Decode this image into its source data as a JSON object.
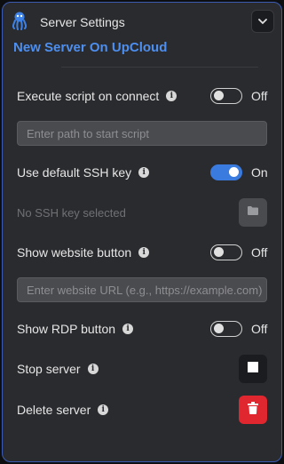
{
  "header": {
    "title": "Server Settings",
    "server_name": "New Server On UpCloud"
  },
  "settings": {
    "execute_script": {
      "label": "Execute script on connect",
      "state": "Off",
      "on": false
    },
    "script_path": {
      "placeholder": "Enter path to start script",
      "value": ""
    },
    "default_ssh": {
      "label": "Use default SSH key",
      "state": "On",
      "on": true
    },
    "ssh_key": {
      "text": "No SSH key selected"
    },
    "website_button": {
      "label": "Show website button",
      "state": "Off",
      "on": false
    },
    "website_url": {
      "placeholder": "Enter website URL (e.g., https://example.com)",
      "value": ""
    },
    "rdp_button": {
      "label": "Show RDP button",
      "state": "Off",
      "on": false
    },
    "stop_server": {
      "label": "Stop server"
    },
    "delete_server": {
      "label": "Delete server"
    }
  },
  "colors": {
    "accent": "#4d8ff0",
    "toggle_on": "#3a7be0",
    "danger": "#e0262f",
    "border": "#3b5bb3"
  },
  "icons": [
    "app-logo-icon",
    "chevron-down-icon",
    "info-icon",
    "folder-icon",
    "stop-icon",
    "trash-icon"
  ]
}
